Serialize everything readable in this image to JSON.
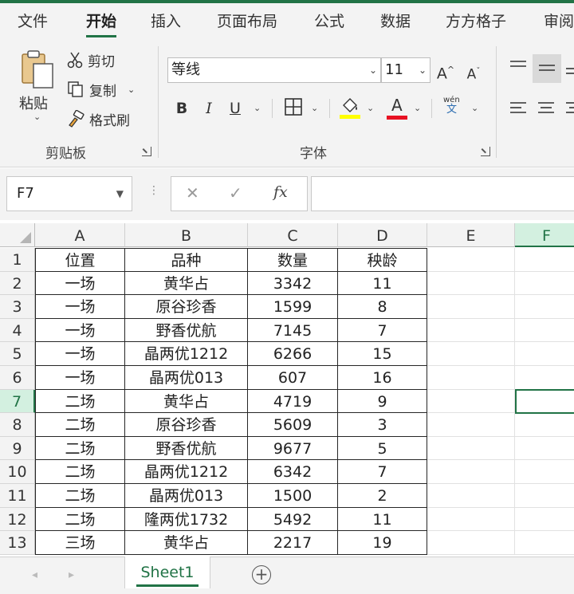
{
  "ribbon_tabs": [
    "文件",
    "开始",
    "插入",
    "页面布局",
    "公式",
    "数据",
    "方方格子",
    "审阅"
  ],
  "active_tab": "开始",
  "clipboard": {
    "paste_label": "粘贴",
    "cut_label": "剪切",
    "copy_label": "复制",
    "format_painter_label": "格式刷",
    "group_label": "剪贴板"
  },
  "font": {
    "font_name": "等线",
    "font_size": "11",
    "group_label": "字体",
    "bold": "B",
    "italic": "I",
    "underline": "U",
    "font_color_letter": "A",
    "phonetic_top": "wén",
    "phonetic_bottom": "文",
    "grow_label": "A",
    "shrink_label": "A",
    "highlight_color": "#ffff00",
    "font_color": "#e81123"
  },
  "formula_bar": {
    "name_box": "F7",
    "fx_label": "fx",
    "formula": ""
  },
  "columns": [
    "A",
    "B",
    "C",
    "D",
    "E",
    "F"
  ],
  "selected_column": "F",
  "selected_row": "7",
  "rows": [
    {
      "num": "1",
      "cells": [
        "位置",
        "品种",
        "数量",
        "秧龄"
      ]
    },
    {
      "num": "2",
      "cells": [
        "一场",
        "黄华占",
        "3342",
        "11"
      ]
    },
    {
      "num": "3",
      "cells": [
        "一场",
        "原谷珍香",
        "1599",
        "8"
      ]
    },
    {
      "num": "4",
      "cells": [
        "一场",
        "野香优航",
        "7145",
        "7"
      ]
    },
    {
      "num": "5",
      "cells": [
        "一场",
        "晶两优1212",
        "6266",
        "15"
      ]
    },
    {
      "num": "6",
      "cells": [
        "一场",
        "晶两优013",
        "607",
        "16"
      ]
    },
    {
      "num": "7",
      "cells": [
        "二场",
        "黄华占",
        "4719",
        "9"
      ]
    },
    {
      "num": "8",
      "cells": [
        "二场",
        "原谷珍香",
        "5609",
        "3"
      ]
    },
    {
      "num": "9",
      "cells": [
        "二场",
        "野香优航",
        "9677",
        "5"
      ]
    },
    {
      "num": "10",
      "cells": [
        "二场",
        "晶两优1212",
        "6342",
        "7"
      ]
    },
    {
      "num": "11",
      "cells": [
        "二场",
        "晶两优013",
        "1500",
        "2"
      ]
    },
    {
      "num": "12",
      "cells": [
        "二场",
        "隆两优1732",
        "5492",
        "11"
      ]
    },
    {
      "num": "13",
      "cells": [
        "三场",
        "黄华占",
        "2217",
        "19"
      ]
    }
  ],
  "sheets": [
    "Sheet1"
  ],
  "accent_color": "#217346"
}
